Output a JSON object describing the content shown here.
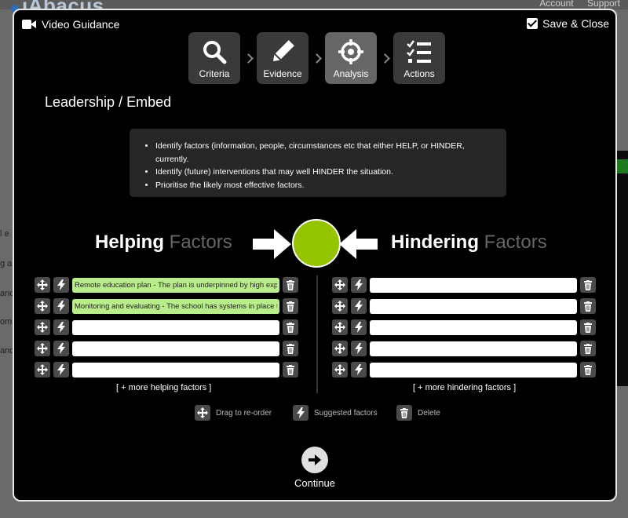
{
  "background": {
    "logo": "iAbacus",
    "links": [
      "Account",
      "Support"
    ],
    "left_fragments": [
      "l e",
      "g a",
      "and",
      "om",
      "and"
    ]
  },
  "modal": {
    "video_guidance_label": "Video Guidance",
    "save_close_label": "Save & Close",
    "steps": [
      {
        "label": "Criteria",
        "icon": "search-icon",
        "active": false
      },
      {
        "label": "Evidence",
        "icon": "pencil-icon",
        "active": false
      },
      {
        "label": "Analysis",
        "icon": "crosshair-icon",
        "active": true
      },
      {
        "label": "Actions",
        "icon": "checklist-icon",
        "active": false
      }
    ],
    "page_title": "Leadership / Embed",
    "instructions": [
      "Identify factors (information, people, circumstances etc that either HELP, or HINDER, currently.",
      "Identify (future) interventions that may well HINDER the situation.",
      "Prioritise the likely most effective factors."
    ],
    "helping": {
      "title_bold": "Helping",
      "title_muted": "Factors",
      "factors": [
        "Remote education plan - The plan is underpinned by high expectations",
        "Monitoring and evaluating - The school has systems in place to",
        "",
        "",
        ""
      ],
      "more_label": "[ + more helping factors ]"
    },
    "hindering": {
      "title_bold": "Hindering",
      "title_muted": "Factors",
      "factors": [
        "",
        "",
        "",
        "",
        ""
      ],
      "more_label": "[ + more hindering factors ]"
    },
    "legend": {
      "drag": "Drag to re-order",
      "suggested": "Suggested factors",
      "delete": "Delete"
    },
    "continue_label": "Continue"
  },
  "colors": {
    "accent_green": "#94c400",
    "filled_factor": "#b9ec8a",
    "active_step": "#666666"
  }
}
